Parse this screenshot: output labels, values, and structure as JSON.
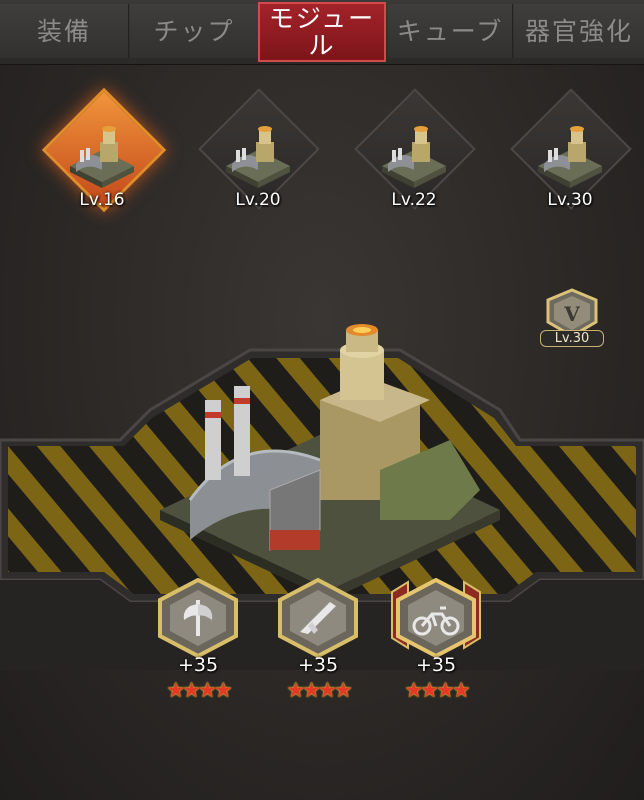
{
  "tabs": [
    {
      "label": "装備"
    },
    {
      "label": "チップ"
    },
    {
      "label": "モジュー\nル"
    },
    {
      "label": "キューブ"
    },
    {
      "label": "器官強化"
    }
  ],
  "modules": [
    {
      "level": "Lv.16",
      "selected": true
    },
    {
      "level": "Lv.20",
      "selected": false
    },
    {
      "level": "Lv.22",
      "selected": false
    },
    {
      "level": "Lv.30",
      "selected": false
    }
  ],
  "rank_badge": {
    "numeral": "V",
    "level": "Lv.30"
  },
  "skills": [
    {
      "icon": "axe-icon",
      "bonus": "+35",
      "stars": "★★★★"
    },
    {
      "icon": "rifle-icon",
      "bonus": "+35",
      "stars": "★★★★"
    },
    {
      "icon": "motorcycle-icon",
      "bonus": "+35",
      "stars": "★★★★"
    }
  ],
  "colors": {
    "active_tab": "#a3232a",
    "selected_slot": "#e08d2a",
    "star": "#e33a26",
    "hazard_yellow": "#c9a21a"
  }
}
